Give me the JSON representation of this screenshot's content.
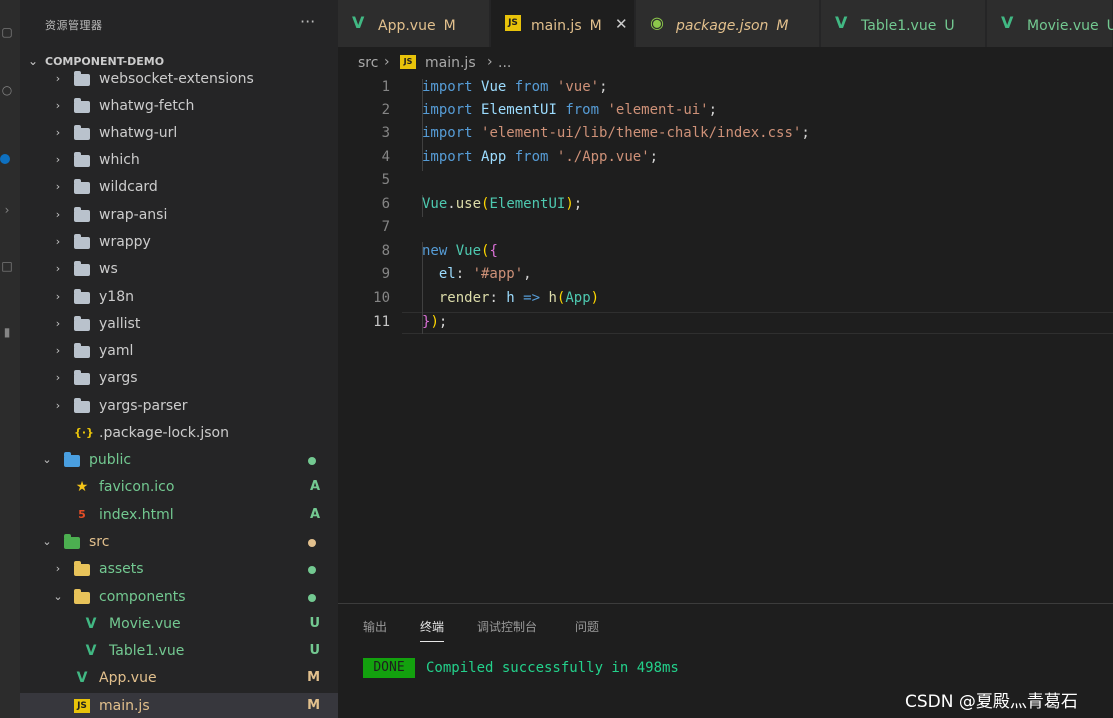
{
  "sidebar": {
    "title": "资源管理器",
    "more_icon": "···",
    "project": "COMPONENT-DEMO",
    "items": [
      {
        "label": "websocket-extensions",
        "type": "folder",
        "icon": "folder-icon",
        "badge": "",
        "color": "#cccccc"
      },
      {
        "label": "whatwg-fetch",
        "type": "folder",
        "icon": "folder-icon",
        "badge": "",
        "color": "#cccccc"
      },
      {
        "label": "whatwg-url",
        "type": "folder",
        "icon": "folder-icon",
        "badge": "",
        "color": "#cccccc"
      },
      {
        "label": "which",
        "type": "folder",
        "icon": "folder-icon",
        "badge": "",
        "color": "#cccccc"
      },
      {
        "label": "wildcard",
        "type": "folder",
        "icon": "folder-icon",
        "badge": "",
        "color": "#cccccc"
      },
      {
        "label": "wrap-ansi",
        "type": "folder",
        "icon": "folder-icon",
        "badge": "",
        "color": "#cccccc"
      },
      {
        "label": "wrappy",
        "type": "folder",
        "icon": "folder-icon",
        "badge": "",
        "color": "#cccccc"
      },
      {
        "label": "ws",
        "type": "folder",
        "icon": "folder-icon",
        "badge": "",
        "color": "#cccccc"
      },
      {
        "label": "y18n",
        "type": "folder",
        "icon": "folder-icon",
        "badge": "",
        "color": "#cccccc"
      },
      {
        "label": "yallist",
        "type": "folder",
        "icon": "folder-icon",
        "badge": "",
        "color": "#cccccc"
      },
      {
        "label": "yaml",
        "type": "folder",
        "icon": "folder-icon",
        "badge": "",
        "color": "#cccccc"
      },
      {
        "label": "yargs",
        "type": "folder",
        "icon": "folder-icon",
        "badge": "",
        "color": "#cccccc"
      },
      {
        "label": "yargs-parser",
        "type": "folder",
        "icon": "folder-icon",
        "badge": "",
        "color": "#cccccc"
      },
      {
        "label": ".package-lock.json",
        "type": "json",
        "icon": "json-icon",
        "badge": "",
        "color": "#cccccc"
      },
      {
        "label": "public",
        "type": "folder-open",
        "icon": "public-folder-icon",
        "badge": "",
        "color": "#73c991"
      },
      {
        "label": "favicon.ico",
        "type": "star",
        "icon": "favicon-icon",
        "badge": "A",
        "color": "#73c991"
      },
      {
        "label": "index.html",
        "type": "html",
        "icon": "html5-icon",
        "badge": "A",
        "color": "#73c991"
      },
      {
        "label": "src",
        "type": "folder-open",
        "icon": "src-folder-icon",
        "badge": "",
        "color": "#e2c08d"
      },
      {
        "label": "assets",
        "type": "folder",
        "icon": "assets-folder-icon",
        "badge": "",
        "color": "#73c991"
      },
      {
        "label": "components",
        "type": "folder-open",
        "icon": "components-folder-icon",
        "badge": "",
        "color": "#73c991"
      },
      {
        "label": "Movie.vue",
        "type": "vue",
        "icon": "vue-icon",
        "badge": "U",
        "color": "#73c991"
      },
      {
        "label": "Table1.vue",
        "type": "vue",
        "icon": "vue-icon",
        "badge": "U",
        "color": "#73c991"
      },
      {
        "label": "App.vue",
        "type": "vue",
        "icon": "vue-icon",
        "badge": "M",
        "color": "#e2c08d"
      },
      {
        "label": "main.js",
        "type": "js",
        "icon": "js-icon",
        "badge": "M",
        "color": "#e2c08d"
      }
    ]
  },
  "tabs": [
    {
      "label": "App.vue",
      "status": "M",
      "icon": "vue-icon",
      "color": "#e2c08d",
      "active": false
    },
    {
      "label": "main.js",
      "status": "M",
      "icon": "js-icon",
      "color": "#e2c08d",
      "active": true,
      "close": "✕"
    },
    {
      "label": "package.json",
      "status": "M",
      "icon": "node-icon",
      "color": "#e2c08d",
      "active": false
    },
    {
      "label": "Table1.vue",
      "status": "U",
      "icon": "vue-icon",
      "color": "#73c991",
      "active": false
    },
    {
      "label": "Movie.vue",
      "status": "U",
      "icon": "vue-icon",
      "color": "#73c991",
      "active": false
    }
  ],
  "breadcrumb": {
    "folder": "src",
    "file": "main.js",
    "symbol": "..."
  },
  "editor": {
    "current_line": 11,
    "line_numbers": [
      "1",
      "2",
      "3",
      "4",
      "5",
      "6",
      "7",
      "8",
      "9",
      "10",
      "11"
    ]
  },
  "panel": {
    "tabs": [
      "输出",
      "终端",
      "调试控制台",
      "问题"
    ],
    "active_tab": "终端",
    "status": "DONE",
    "message": "Compiled successfully in 498ms"
  },
  "watermark": "CSDN @夏殿灬青葛石",
  "colors": {
    "modified": "#e2c08d",
    "untracked": "#73c991",
    "done_green": "#13a10e",
    "keyword": "#569cd6",
    "string": "#ce9178"
  }
}
